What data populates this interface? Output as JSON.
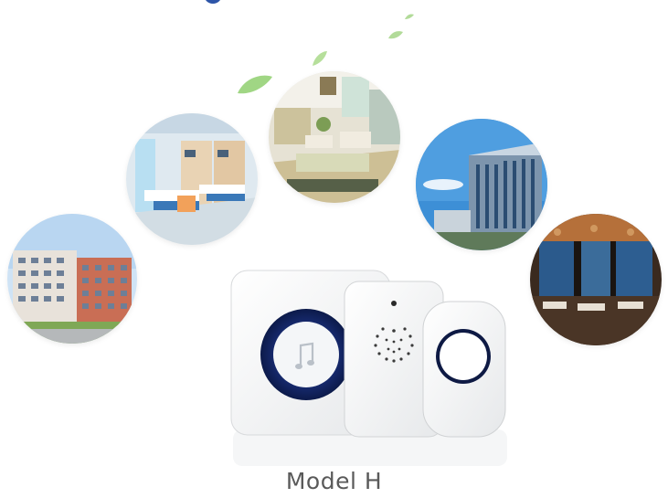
{
  "caption": "Model H",
  "colors": {
    "accent_navy": "#1c2a6b",
    "leaf_green": "#8fcf6e",
    "caption_gray": "#5a5a5a"
  },
  "scenes": [
    "apartment-building",
    "hospital-ward",
    "hotel-lounge",
    "office-tower",
    "restaurant-interior"
  ],
  "icons": [
    "music-note-icon"
  ]
}
